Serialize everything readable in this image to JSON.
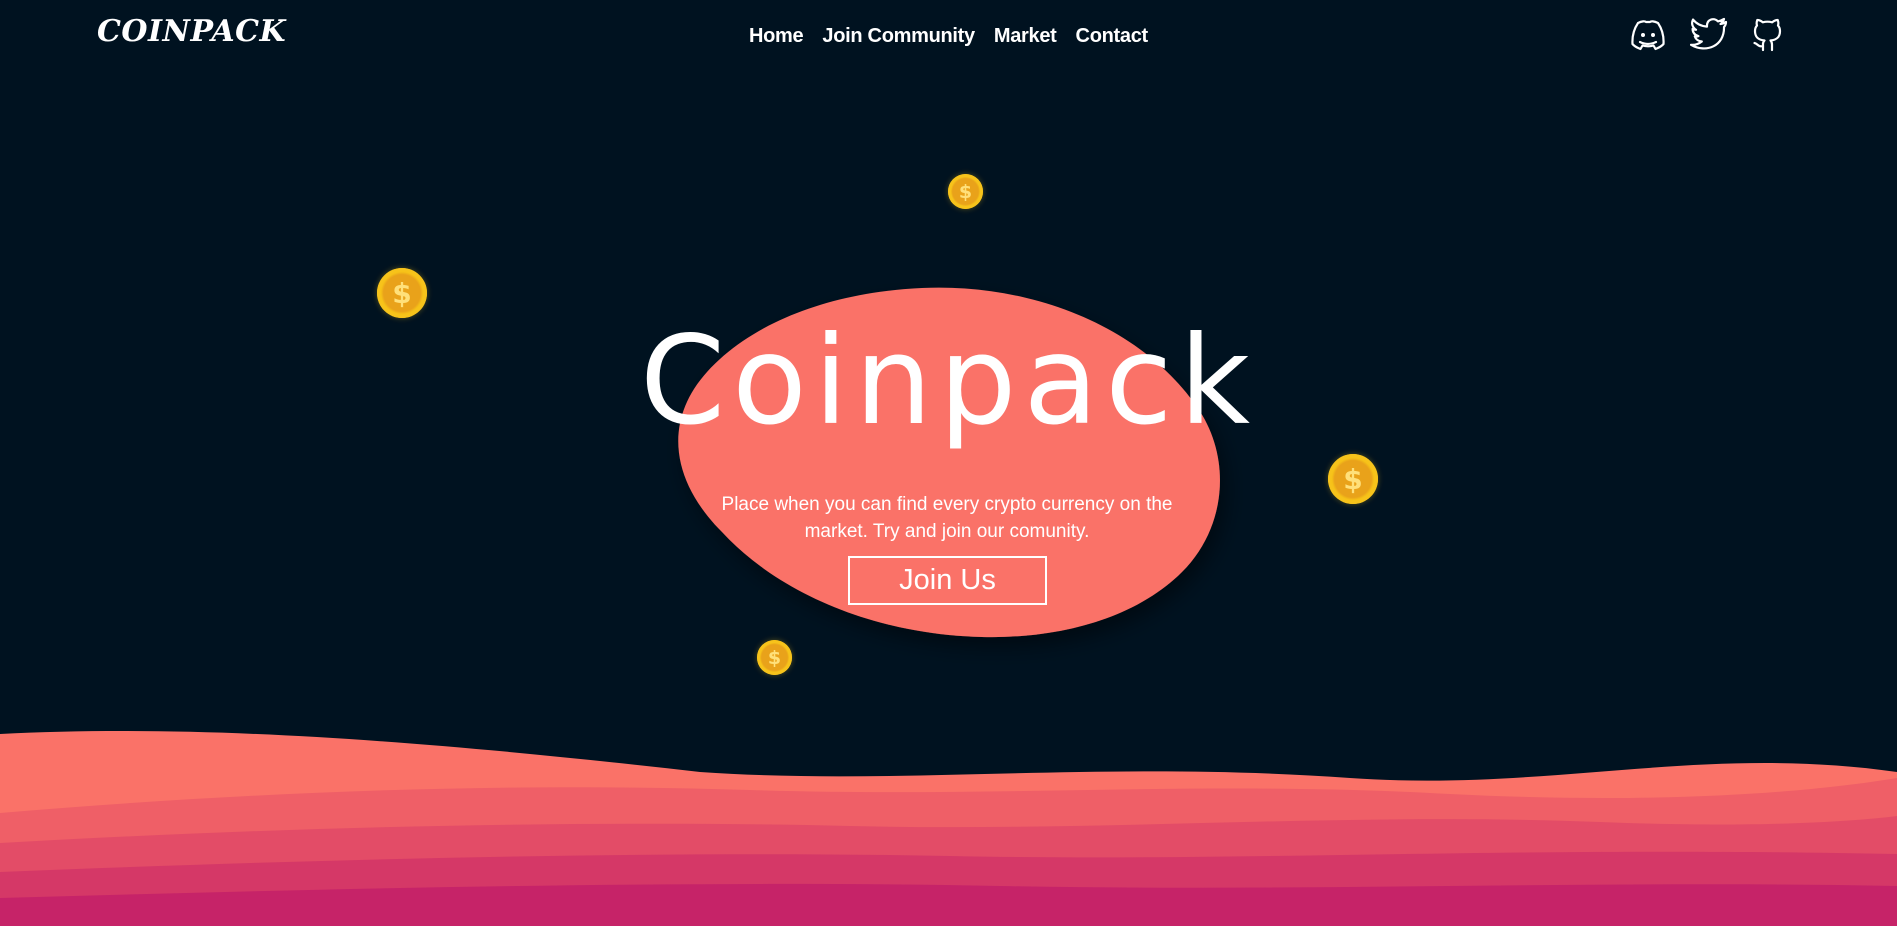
{
  "brand": {
    "logo_text": "COINPACK"
  },
  "nav": {
    "links": [
      {
        "label": "Home"
      },
      {
        "label": "Join Community"
      },
      {
        "label": "Market"
      },
      {
        "label": "Contact"
      }
    ]
  },
  "social": [
    {
      "icon": "discord-icon"
    },
    {
      "icon": "twitter-icon"
    },
    {
      "icon": "github-icon"
    }
  ],
  "hero": {
    "title": "Coinpack",
    "subtitle": "Place when you can find every crypto currency on the market. Try and join our comunity.",
    "cta_label": "Join Us"
  },
  "decor": {
    "coin_symbol": "$"
  },
  "colors": {
    "background": "#001220",
    "accent": "#fa7268",
    "coin": "#f7c31b",
    "wave_layers": [
      "#fa7268",
      "#ef5f67",
      "#e34c67",
      "#d53867",
      "#c62368"
    ]
  }
}
